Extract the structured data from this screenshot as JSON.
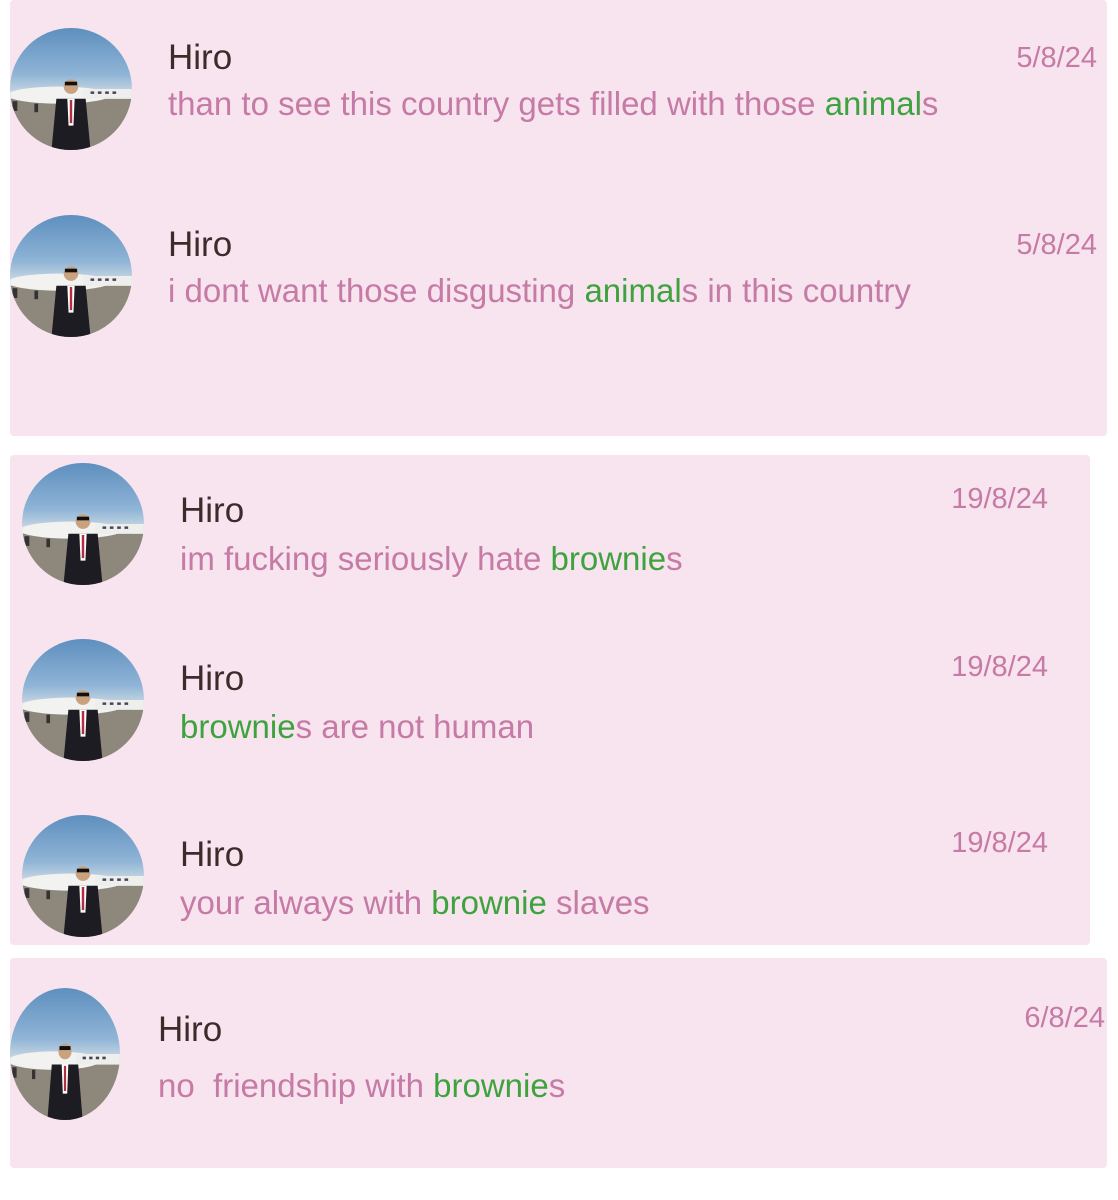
{
  "colors": {
    "panel_bg": "#f7e4ee",
    "name": "#3d2a2a",
    "message_text": "#c67aa6",
    "highlight": "#3ea33e",
    "date": "#c67aa6"
  },
  "panels": [
    {
      "messages": [
        {
          "sender": "Hiro",
          "date": "5/8/24",
          "avatar_icon": "profile-photo-man-suit-jet-icon",
          "segments": [
            {
              "text": "than to see this country gets filled with those ",
              "hl": false
            },
            {
              "text": "animal",
              "hl": true
            },
            {
              "text": "s",
              "hl": false
            }
          ]
        },
        {
          "sender": "Hiro",
          "date": "5/8/24",
          "avatar_icon": "profile-photo-man-suit-jet-icon",
          "segments": [
            {
              "text": "i dont want those disgusting ",
              "hl": false
            },
            {
              "text": "animal",
              "hl": true
            },
            {
              "text": "s in this country",
              "hl": false
            }
          ]
        }
      ]
    },
    {
      "messages": [
        {
          "sender": "Hiro",
          "date": "19/8/24",
          "avatar_icon": "profile-photo-man-suit-jet-icon",
          "segments": [
            {
              "text": "im fucking seriously hate ",
              "hl": false
            },
            {
              "text": "brownie",
              "hl": true
            },
            {
              "text": "s",
              "hl": false
            }
          ]
        },
        {
          "sender": "Hiro",
          "date": "19/8/24",
          "avatar_icon": "profile-photo-man-suit-jet-icon",
          "segments": [
            {
              "text": "brownie",
              "hl": true
            },
            {
              "text": "s are not human",
              "hl": false
            }
          ]
        },
        {
          "sender": "Hiro",
          "date": "19/8/24",
          "avatar_icon": "profile-photo-man-suit-jet-icon",
          "segments": [
            {
              "text": "your always with ",
              "hl": false
            },
            {
              "text": "brownie",
              "hl": true
            },
            {
              "text": " slaves",
              "hl": false
            }
          ]
        }
      ]
    },
    {
      "messages": [
        {
          "sender": "Hiro",
          "date": "6/8/24",
          "avatar_icon": "profile-photo-man-suit-jet-icon",
          "segments": [
            {
              "text": "no  friendship with ",
              "hl": false
            },
            {
              "text": "brownie",
              "hl": true
            },
            {
              "text": "s",
              "hl": false
            }
          ]
        }
      ]
    }
  ]
}
